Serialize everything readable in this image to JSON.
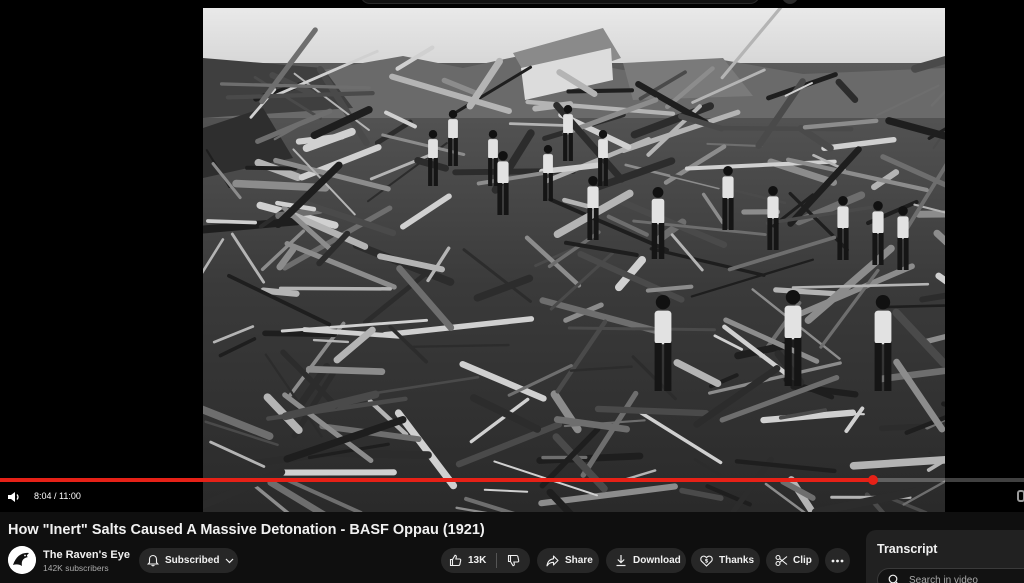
{
  "player": {
    "current_time": "8:04",
    "separator": " / ",
    "duration": "11:00",
    "progress_fraction": 0.853
  },
  "video": {
    "title": "How \"Inert\" Salts Caused A Massive Detonation - BASF Oppau (1921)"
  },
  "channel": {
    "name": "The Raven's Eye",
    "subscribers": "142K subscribers"
  },
  "actions": {
    "subscribed_label": "Subscribed",
    "like_count": "13K",
    "share_label": "Share",
    "download_label": "Download",
    "thanks_label": "Thanks",
    "clip_label": "Clip"
  },
  "transcript": {
    "title": "Transcript",
    "search_placeholder": "Search in video"
  },
  "colors": {
    "progress": "#e62117",
    "page_bg": "#0f0f0f",
    "pill_bg": "#272727"
  },
  "icons": [
    "volume-icon",
    "bell-icon",
    "chevron-down-icon",
    "thumbs-up-icon",
    "thumbs-down-icon",
    "share-icon",
    "download-icon",
    "thanks-icon",
    "scissors-icon",
    "more-icon",
    "search-icon"
  ]
}
